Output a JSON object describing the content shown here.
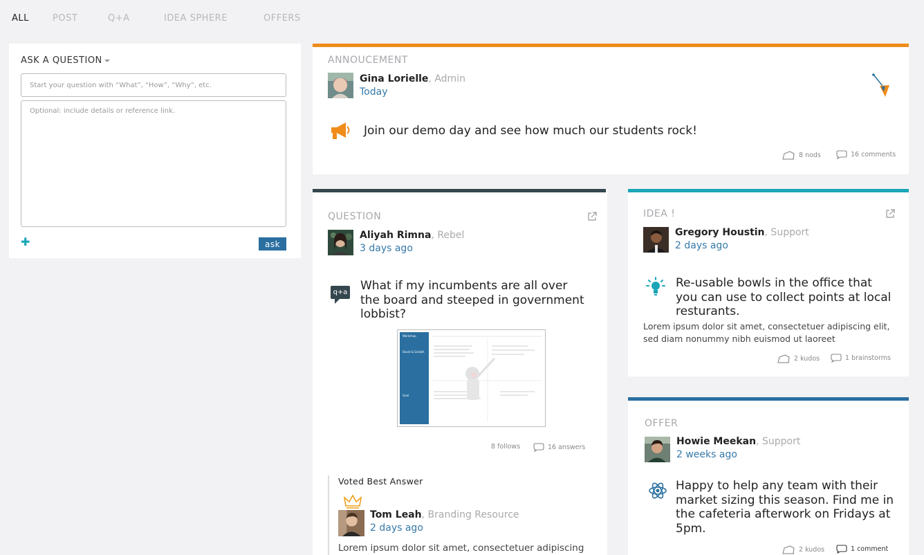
{
  "tabs": [
    {
      "label": "ALL",
      "active": true
    },
    {
      "label": "POST",
      "active": false
    },
    {
      "label": "Q+A",
      "active": false
    },
    {
      "label": "IDEA SPHERE",
      "active": false
    },
    {
      "label": "OFFERS",
      "active": false
    }
  ],
  "ask": {
    "title": "ASK A QUESTION",
    "question_placeholder": "Start your question with “What”, “How”, “Why”, etc.",
    "details_placeholder": "Optional: include details or reference link.",
    "add_label": "✚",
    "ask_label": "ask"
  },
  "announcement": {
    "type_label": "ANNOUCEMENT",
    "accent": "#ef8c1a",
    "author": "Gina Lorielle",
    "role": ", Admin",
    "time": "Today",
    "text": "Join our demo day and see how much our students rock!",
    "nods": "8 nods",
    "comments": "16 comments"
  },
  "question": {
    "type_label": "QUESTION",
    "accent": "#34464e",
    "author": "Aliyah Rimna",
    "role": ", Rebel",
    "time": "3 days ago",
    "qa_icon_text": "q+a",
    "text": "What if my incumbents are all over the board and steeped in government lobbist?",
    "attachment": {
      "sidebar_heading": "Workshop",
      "sidebar_title": "David & Goliath",
      "sidebar_goal": "Goal"
    },
    "follows": "8 follows",
    "answers": "16 answers",
    "best_answer": {
      "heading": "Voted Best Answer",
      "author": "Tom Leah",
      "role": ", Branding Resource",
      "time": "2 days ago",
      "text": "Lorem ipsum dolor sit amet, consectetuer adipiscing"
    }
  },
  "idea": {
    "type_label": "IDEA !",
    "accent": "#1aa6b7",
    "author": "Gregory Houstin",
    "role": ", Support",
    "time": "2 days ago",
    "text": "Re-usable bowls in the office that you can use to collect points at local resturants.",
    "detail": "Lorem ipsum dolor sit amet, consectetuer adipiscing elit, sed diam nonummy nibh euismod ut laoreet",
    "kudos": "2 kudos",
    "brainstorms": "1 brainstorms"
  },
  "offer": {
    "type_label": "OFFER",
    "accent": "#2a6fa0",
    "author": "Howie Meekan",
    "role": ", Support",
    "time": "2 weeks ago",
    "text": "Happy to help any team with their market sizing this season. Find me in the cafeteria afterwork on Fridays at 5pm.",
    "kudos": "2 kudos",
    "comments": "1 comment"
  }
}
